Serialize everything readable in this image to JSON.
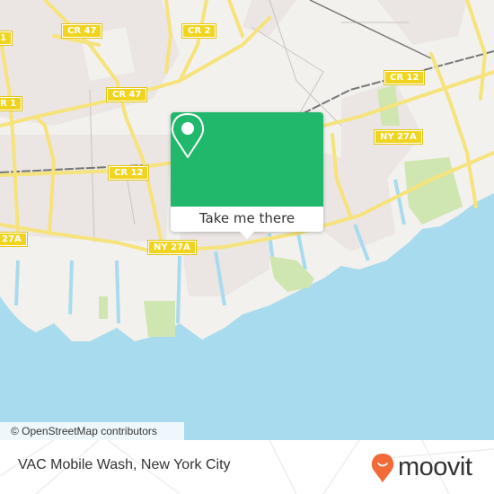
{
  "map": {
    "road_labels": [
      {
        "id": "cr47-top",
        "text": "CR 47"
      },
      {
        "id": "cr2",
        "text": "CR 2"
      },
      {
        "id": "cr1-top",
        "text": "1"
      },
      {
        "id": "cr1-mid",
        "text": "R 1"
      },
      {
        "id": "cr47-mid",
        "text": "CR 47"
      },
      {
        "id": "cr12-right",
        "text": "CR 12"
      },
      {
        "id": "cr12-left",
        "text": "CR 12"
      },
      {
        "id": "ny27a-right",
        "text": "NY 27A"
      },
      {
        "id": "ny27a-left-edge",
        "text": "27A"
      },
      {
        "id": "ny27a-mid",
        "text": "NY 27A"
      }
    ],
    "colors": {
      "land": "#f2f1ee",
      "residential": "#ebe6e3",
      "water": "#a9dbee",
      "park": "#cfe6b0",
      "road": "#f6e37c",
      "shield": "#f1d41f",
      "popup": "#21b86c"
    }
  },
  "popup": {
    "icon": "location-pin-icon",
    "button_label": "Take me there"
  },
  "attribution": "© OpenStreetMap contributors",
  "footer": {
    "title": "VAC Mobile Wash, New York City",
    "logo_text": "moovit",
    "logo_icon": "moovit-pin-icon",
    "logo_color": "#f26a37"
  }
}
